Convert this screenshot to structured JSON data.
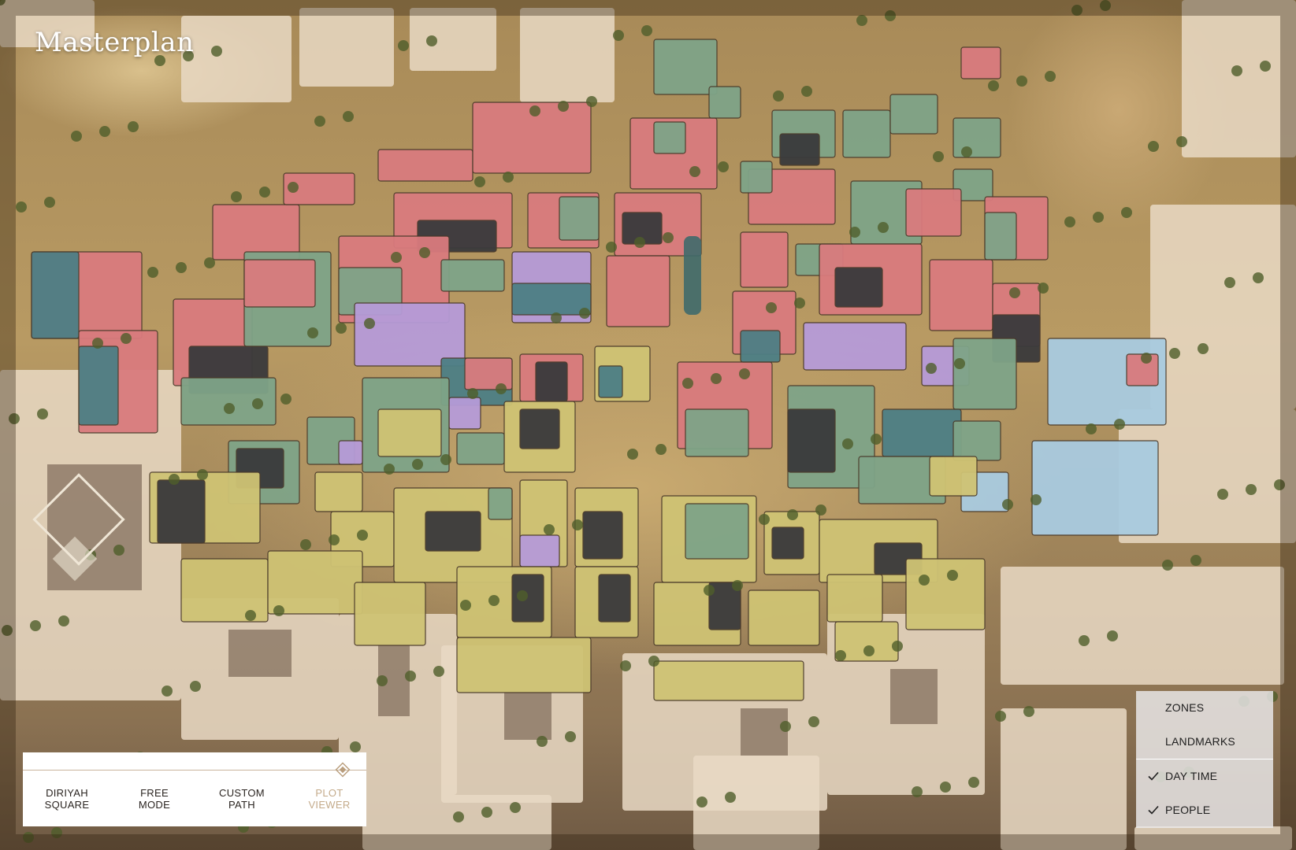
{
  "app": {
    "title": "Masterplan"
  },
  "colors": {
    "residential": "#d97b7e",
    "mixed": "#7fa488",
    "retail": "#cfc374",
    "cultural": "#b69bd8",
    "hospitality": "#a9cbe0",
    "dark_block": "#3a3a3c",
    "teal_block": "#4d7f85",
    "active_mode": "#c4ab8b"
  },
  "modes": [
    {
      "line1": "DIRIYAH",
      "line2": "SQUARE",
      "active": false
    },
    {
      "line1": "FREE",
      "line2": "MODE",
      "active": false
    },
    {
      "line1": "CUSTOM",
      "line2": "PATH",
      "active": false
    },
    {
      "line1": "PLOT",
      "line2": "VIEWER",
      "active": true
    }
  ],
  "layers": [
    {
      "label": "ZONES",
      "checked": false
    },
    {
      "label": "LANDMARKS",
      "checked": false
    },
    {
      "label": "DAY TIME",
      "checked": true
    },
    {
      "label": "PEOPLE",
      "checked": true
    }
  ],
  "icons": {
    "mode_indicator": "diamond-icon",
    "layer_check": "check-icon"
  }
}
